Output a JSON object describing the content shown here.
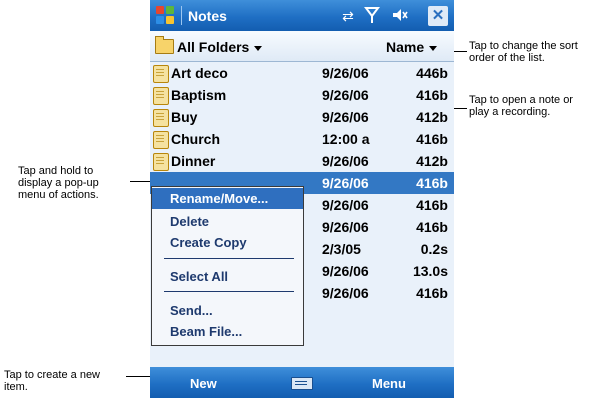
{
  "callouts": {
    "sort": "Tap to change the sort order of the list.",
    "open": "Tap to open a note or play a recording.",
    "hold": "Tap and hold to display a pop-up menu of actions.",
    "create": "Tap to create a new item."
  },
  "titlebar": {
    "title": "Notes",
    "icons": [
      "windows-logo",
      "connectivity-icon",
      "signal-icon",
      "volume-icon",
      "close-icon"
    ]
  },
  "header": {
    "folder": "All Folders",
    "sort": "Name"
  },
  "notes": [
    {
      "name": "Art deco",
      "date": "9/26/06",
      "size": "446b",
      "icon": "note-icon"
    },
    {
      "name": "Baptism",
      "date": "9/26/06",
      "size": "416b",
      "icon": "note-icon"
    },
    {
      "name": "Buy",
      "date": "9/26/06",
      "size": "412b",
      "icon": "note-icon"
    },
    {
      "name": "Church",
      "date": "12:00 a",
      "size": "416b",
      "icon": "note-icon"
    },
    {
      "name": "Dinner",
      "date": "9/26/06",
      "size": "412b",
      "icon": "note-icon"
    },
    {
      "name": "",
      "date": "9/26/06",
      "size": "416b",
      "selected": true
    },
    {
      "name": "",
      "date": "9/26/06",
      "size": "416b"
    },
    {
      "name": "",
      "date": "9/26/06",
      "size": "416b"
    },
    {
      "name": "",
      "date": "2/3/05",
      "size": "0.2s"
    },
    {
      "name": "",
      "date": "9/26/06",
      "size": "13.0s"
    },
    {
      "name": "",
      "date": "9/26/06",
      "size": "416b"
    }
  ],
  "context_menu": {
    "items": [
      "Rename/Move...",
      "Delete",
      "Create Copy",
      "Select All",
      "Send...",
      "Beam File..."
    ],
    "highlighted": "Rename/Move..."
  },
  "bottombar": {
    "left": "New",
    "right": "Menu",
    "input_icon": "keyboard-icon"
  },
  "colors": {
    "titlebar": "#1f6fc4",
    "selection": "#3378c4",
    "background": "#e9f1fa"
  }
}
